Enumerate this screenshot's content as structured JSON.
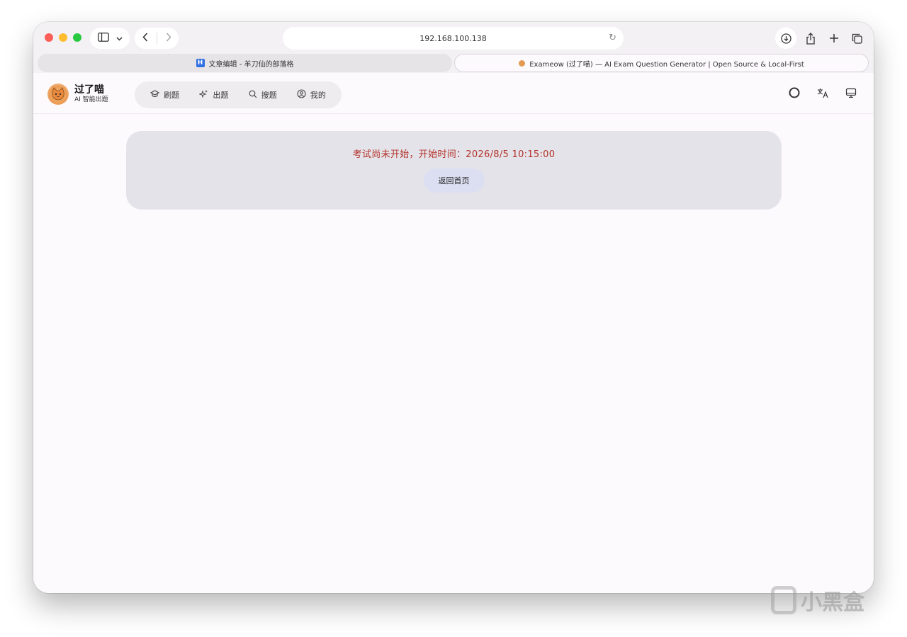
{
  "browser": {
    "address": "192.168.100.138",
    "tabs": [
      {
        "label": "文章编辑 - 羊刀仙的部落格",
        "favicon": "H",
        "active": false
      },
      {
        "label": "Exameow (过了喵) — AI Exam Question Generator | Open Source & Local-First",
        "active": true
      }
    ]
  },
  "app": {
    "brand": {
      "title": "过了喵",
      "subtitle": "AI 智能出题"
    },
    "nav": [
      {
        "label": "刷题",
        "icon": "graduation-cap-icon"
      },
      {
        "label": "出题",
        "icon": "sparkles-icon"
      },
      {
        "label": "搜题",
        "icon": "search-icon"
      },
      {
        "label": "我的",
        "icon": "user-circle-icon"
      }
    ],
    "header_icons": [
      "github-icon",
      "translate-icon",
      "monitor-icon"
    ]
  },
  "notice": {
    "message": "考试尚未开始，开始时间：2026/8/5 10:15:00",
    "button": "返回首页",
    "message_color": "#b3322a"
  },
  "watermark": {
    "text": "小黑盒"
  }
}
